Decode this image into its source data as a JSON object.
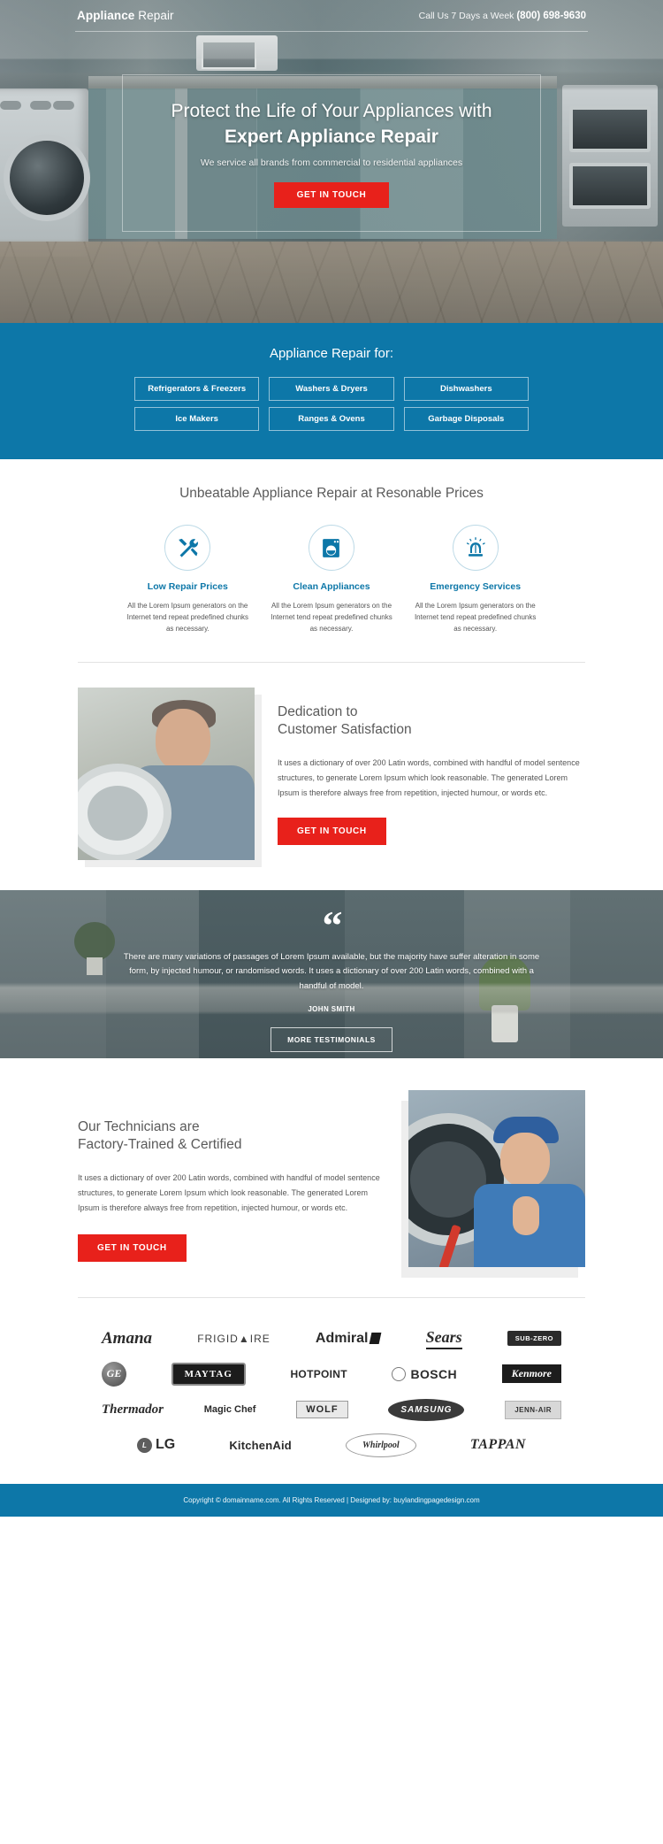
{
  "header": {
    "logo_bold": "Appliance",
    "logo_light": " Repair",
    "phone_prefix": "Call Us 7 Days a Week ",
    "phone_number": "(800) 698-9630"
  },
  "hero": {
    "headline_line1": "Protect the Life of Your Appliances with",
    "headline_line2": "Expert Appliance Repair",
    "subheadline": "We service all brands from commercial to residential appliances",
    "cta_label": "GET IN TOUCH"
  },
  "services": {
    "title": "Appliance Repair for:",
    "items": [
      "Refrigerators & Freezers",
      "Washers & Dryers",
      "Dishwashers",
      "Ice Makers",
      "Ranges & Ovens",
      "Garbage Disposals"
    ]
  },
  "features": {
    "title": "Unbeatable Appliance Repair at Resonable Prices",
    "items": [
      {
        "icon": "tools-icon",
        "title": "Low Repair Prices",
        "body": "All the Lorem Ipsum generators on the Internet tend repeat predefined chunks as necessary."
      },
      {
        "icon": "washing-machine-icon",
        "title": "Clean Appliances",
        "body": "All the Lorem Ipsum generators on the Internet tend repeat predefined chunks as necessary."
      },
      {
        "icon": "siren-icon",
        "title": "Emergency Services",
        "body": "All the Lorem Ipsum generators on the Internet tend repeat predefined chunks as necessary."
      }
    ]
  },
  "dedication": {
    "title_line1": "Dedication to",
    "title_line2": "Customer Satisfaction",
    "body": "It uses a dictionary of over 200 Latin words, combined with handful of model sentence structures, to generate Lorem Ipsum which look reasonable. The generated Lorem Ipsum is therefore always free from repetition, injected humour, or words etc.",
    "cta_label": "GET IN TOUCH",
    "image_alt": "technician-repairing-washing-machine-photo"
  },
  "testimonial": {
    "quote_glyph": "“",
    "quote": "There are many variations of passages of Lorem Ipsum available, but the majority have suffer alteration in some form, by injected humour, or randomised words. It uses a dictionary of over 200 Latin words, combined with a handful of model.",
    "author": "JOHN SMITH",
    "cta_label": "MORE TESTIMONIALS"
  },
  "technicians": {
    "title_line1": "Our Technicians are",
    "title_line2": "Factory-Trained & Certified",
    "body": "It uses a dictionary of over 200 Latin words, combined with handful of model sentence structures, to generate Lorem Ipsum which look reasonable. The generated Lorem Ipsum is therefore always free from repetition, injected humour, or words etc.",
    "cta_label": "GET IN TOUCH",
    "image_alt": "smiling-technician-thumbs-up-photo"
  },
  "brands": {
    "rows": [
      [
        "Amana",
        "FRIGID▲IRE",
        "Admiral",
        "Sears",
        "SUB-ZERO"
      ],
      [
        "GE",
        "MAYTAG",
        "HOTPOINT",
        "BOSCH",
        "Kenmore"
      ],
      [
        "Thermador",
        "Magic Chef",
        "WOLF",
        "SAMSUNG",
        "JENN-AIR"
      ],
      [
        "LG",
        "KitchenAid",
        "Whirlpool",
        "TAPPAN"
      ]
    ]
  },
  "footer": {
    "text": "Copyright © domainname.com. All Rights Reserved  |  Designed by: buylandingpagedesign.com"
  },
  "colors": {
    "accent_blue": "#0d77a8",
    "cta_red": "#e8211b",
    "heading_gray": "#5a5a5a"
  }
}
